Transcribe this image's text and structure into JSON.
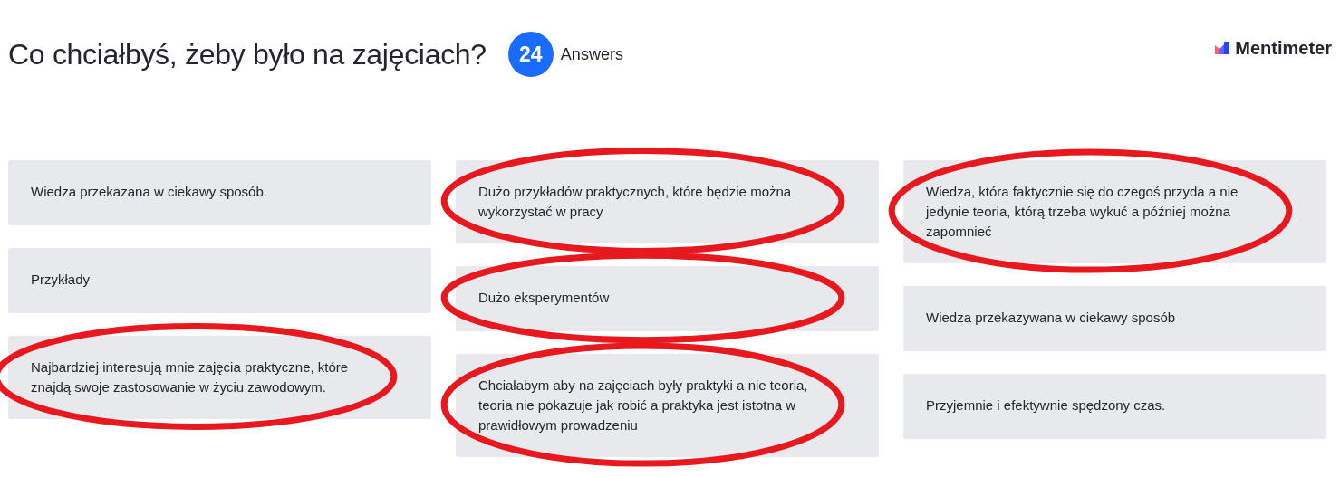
{
  "title": "Co chciałbyś, żeby było na zajęciach?",
  "answer_count": "24",
  "answer_label": "Answers",
  "logo": "Mentimeter",
  "columns": [
    [
      {
        "text": "Wiedza przekazana w ciekawy sposób.",
        "circled": false
      },
      {
        "text": "Przykłady",
        "circled": false
      },
      {
        "text": "Najbardziej interesują mnie zajęcia praktyczne, które znajdą swoje zastosowanie w życiu zawodowym.",
        "circled": true
      }
    ],
    [
      {
        "text": "Dużo przykładów praktycznych, które będzie można wykorzystać w pracy",
        "circled": true
      },
      {
        "text": "Dużo eksperymentów",
        "circled": true
      },
      {
        "text": "Chciałabym aby na zajęciach były praktyki a nie teoria, teoria nie pokazuje jak robić a praktyka jest istotna w prawidłowym prowadzeniu",
        "circled": true
      }
    ],
    [
      {
        "text": "Wiedza, która faktycznie się do czegoś przyda a nie jedynie teoria, którą trzeba wykuć a później można zapomnieć",
        "circled": true
      },
      {
        "text": "Wiedza przekazywana w ciekawy sposób",
        "circled": false
      },
      {
        "text": "Przyjemnie i efektywnie spędzony czas.",
        "circled": false
      }
    ]
  ]
}
